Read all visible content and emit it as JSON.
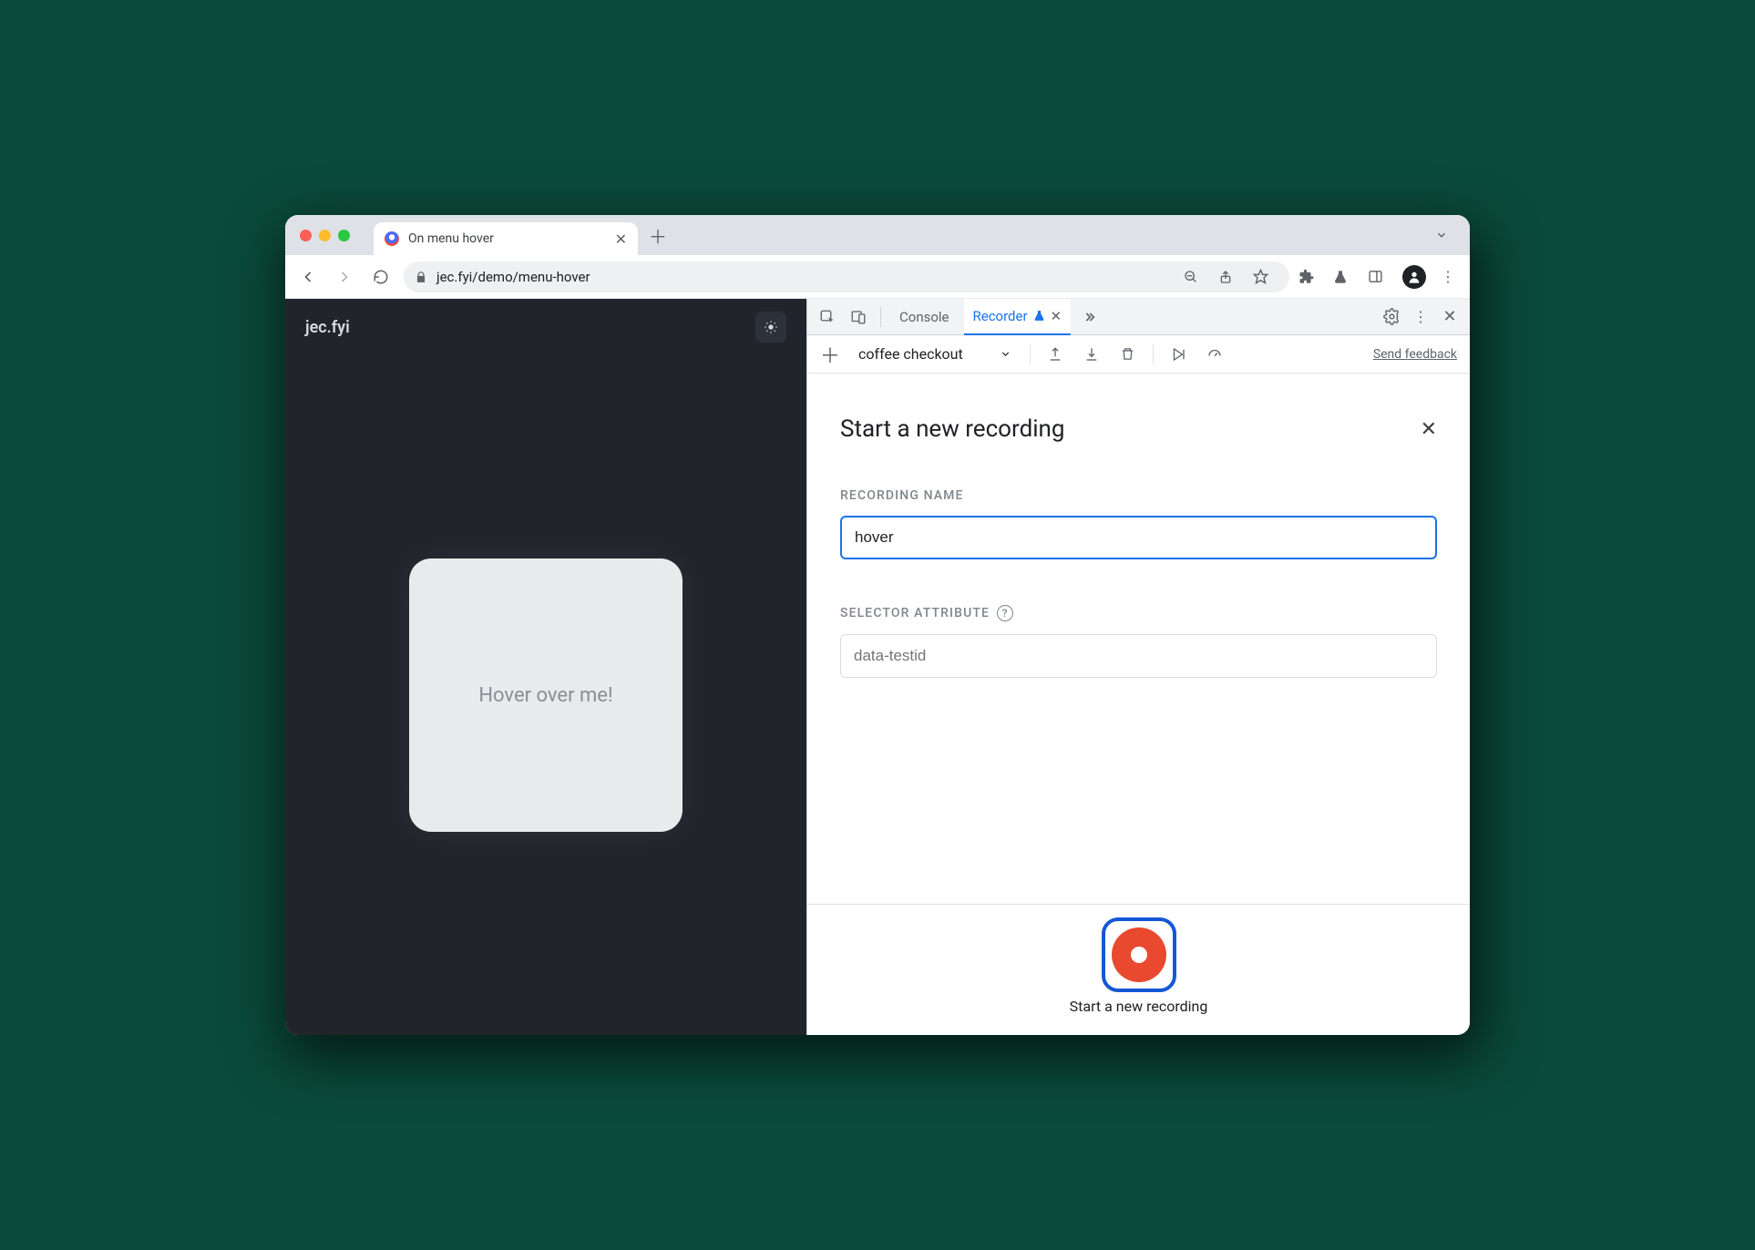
{
  "browser": {
    "tab_title": "On menu hover",
    "url": "jec.fyi/demo/menu-hover"
  },
  "page": {
    "site_title": "jec.fyi",
    "card_text": "Hover over me!"
  },
  "devtools": {
    "tabs": {
      "console": "Console",
      "recorder": "Recorder"
    },
    "toolbar": {
      "dropdown": "coffee checkout",
      "feedback": "Send feedback"
    },
    "panel": {
      "title": "Start a new recording",
      "name_label": "RECORDING NAME",
      "name_value": "hover",
      "selector_label": "SELECTOR ATTRIBUTE",
      "selector_placeholder": "data-testid",
      "record_label": "Start a new recording"
    }
  }
}
